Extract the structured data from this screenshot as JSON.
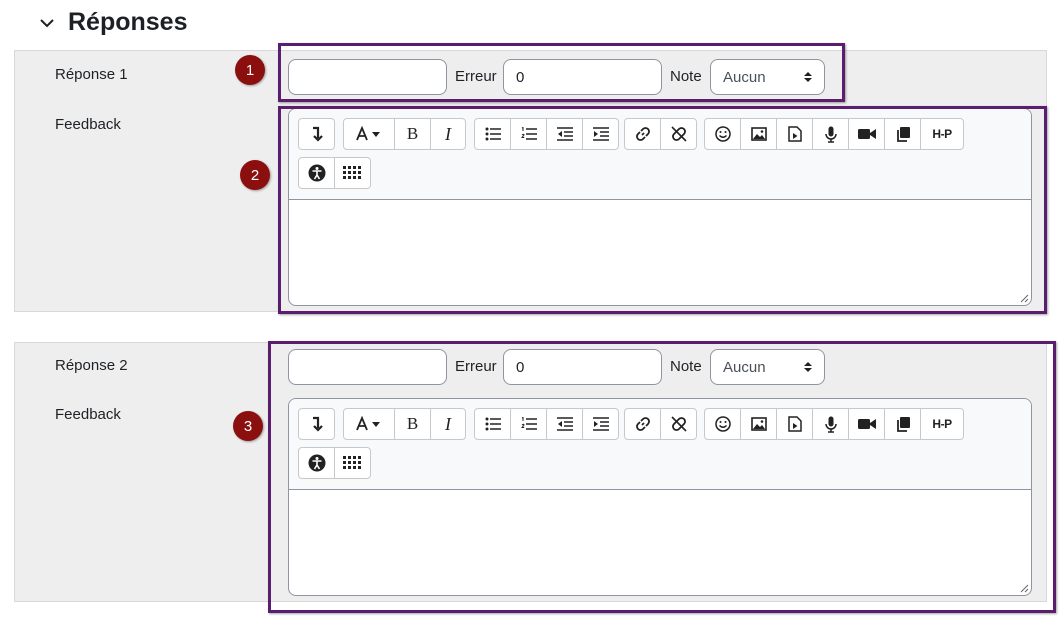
{
  "section": {
    "title": "Réponses",
    "icon": "chevron-down-icon"
  },
  "answers": [
    {
      "label": "Réponse 1",
      "answer_value": "",
      "error_label": "Erreur",
      "error_value": "0",
      "note_label": "Note",
      "note_selected": "Aucun",
      "feedback_label": "Feedback",
      "feedback_content": ""
    },
    {
      "label": "Réponse 2",
      "answer_value": "",
      "error_label": "Erreur",
      "error_value": "0",
      "note_label": "Note",
      "note_selected": "Aucun",
      "feedback_label": "Feedback",
      "feedback_content": ""
    }
  ],
  "toolbar_icons": [
    "collapse-icon",
    "font-color-icon",
    "bold-icon",
    "italic-icon",
    "unordered-list-icon",
    "ordered-list-icon",
    "outdent-icon",
    "indent-icon",
    "link-icon",
    "unlink-icon",
    "emoji-icon",
    "image-icon",
    "media-file-icon",
    "record-audio-icon",
    "record-video-icon",
    "manage-files-icon",
    "h5p-icon",
    "accessibility-icon",
    "screenreader-helper-icon"
  ],
  "toolbar_text": {
    "bold": "B",
    "italic": "I",
    "h5p": "H-P"
  },
  "callouts": {
    "one": "1",
    "two": "2",
    "three": "3"
  },
  "colors": {
    "highlight": "#5b1e6e",
    "badge": "#8c0f0f",
    "panel": "#eeeeee"
  }
}
